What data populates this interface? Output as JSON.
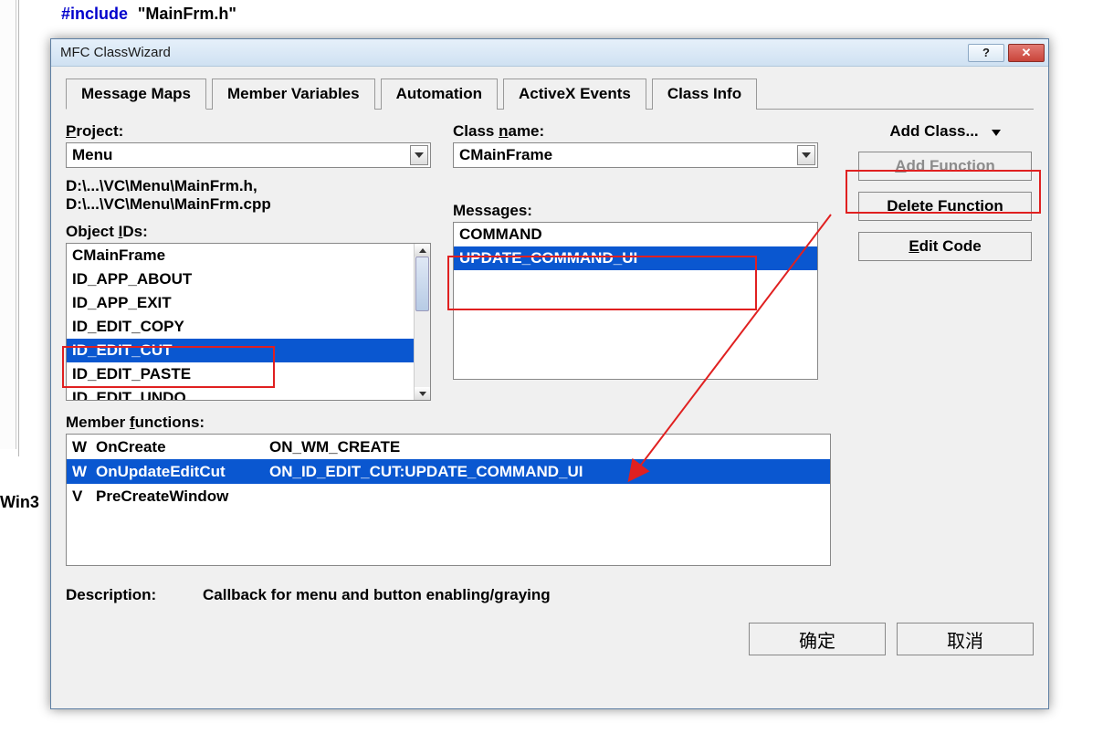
{
  "code": {
    "include": "#include",
    "file": "\"MainFrm.h\""
  },
  "bg_text": "Win3",
  "window": {
    "title": "MFC ClassWizard",
    "help": "?",
    "close": "✕",
    "tabs": [
      "Message Maps",
      "Member Variables",
      "Automation",
      "ActiveX Events",
      "Class Info"
    ],
    "active_tab": "Message Maps",
    "project_label": "Project:",
    "project_value": "Menu",
    "classname_label": "Class name:",
    "classname_value": "CMainFrame",
    "path": "D:\\...\\VC\\Menu\\MainFrm.h, D:\\...\\VC\\Menu\\MainFrm.cpp",
    "objectids_label": "Object IDs:",
    "object_ids": [
      "CMainFrame",
      "ID_APP_ABOUT",
      "ID_APP_EXIT",
      "ID_EDIT_COPY",
      "ID_EDIT_CUT",
      "ID_EDIT_PASTE",
      "ID_EDIT_UNDO"
    ],
    "object_selected": "ID_EDIT_CUT",
    "messages_label": "Messages:",
    "messages": [
      "COMMAND",
      "UPDATE_COMMAND_UI"
    ],
    "messages_selected": "UPDATE_COMMAND_UI",
    "btn_addclass": "Add Class...",
    "btn_addfunction": "Add Function",
    "btn_deletefunction": "Delete Function",
    "btn_editcode": "Edit Code",
    "memberfns_label": "Member functions:",
    "member_fns": [
      {
        "tag": "W",
        "name": "OnCreate",
        "map": "ON_WM_CREATE"
      },
      {
        "tag": "W",
        "name": "OnUpdateEditCut",
        "map": "ON_ID_EDIT_CUT:UPDATE_COMMAND_UI"
      },
      {
        "tag": "V",
        "name": "PreCreateWindow",
        "map": ""
      }
    ],
    "member_selected": 1,
    "description_label": "Description:",
    "description_text": "Callback for menu and button enabling/graying",
    "ok": "确定",
    "cancel": "取消"
  }
}
